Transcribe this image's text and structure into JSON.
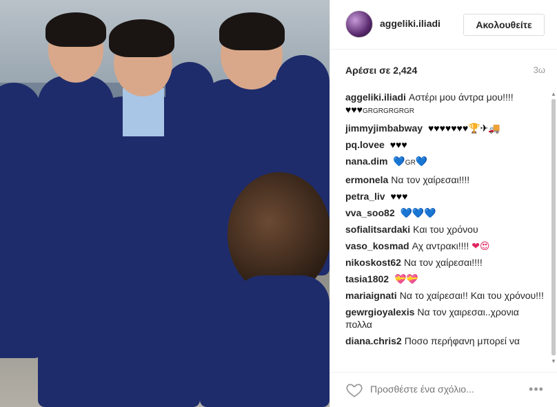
{
  "post": {
    "username": "aggeliki.iliadi",
    "follow_label": "Ακολουθείτε",
    "likes_text": "Αρέσει σε 2,424",
    "time_ago": "3ω"
  },
  "comments": [
    {
      "user": "aggeliki.iliadi",
      "text": "Αστέρι μου άντρα μου!!!!",
      "extra_icons": "♥♥♥",
      "extra_small": "GRGRGRGRGR",
      "heart_color": "black"
    },
    {
      "user": "jimmyjimbabway",
      "text": "",
      "extra_icons": "♥♥♥♥♥♥♥🏆✈🚚",
      "heart_color": "black"
    },
    {
      "user": "pq.lovee",
      "text": "",
      "extra_icons": "♥♥♥",
      "heart_color": "black"
    },
    {
      "user": "nana.dim",
      "text": "",
      "extra_icons": "💙",
      "extra_small": "GR",
      "extra_icons_after": "💙",
      "heart_color": "blue"
    },
    {
      "user": "ermonela",
      "text": "Να τον χαίρεσαι!!!!",
      "heart_color": ""
    },
    {
      "user": "petra_liv",
      "text": "",
      "extra_icons": "♥♥♥",
      "heart_color": "black"
    },
    {
      "user": "vva_soo82",
      "text": "",
      "extra_icons": "💙💙💙",
      "heart_color": "blue"
    },
    {
      "user": "sofialitsardaki",
      "text": "Και του χρόνου",
      "heart_color": ""
    },
    {
      "user": "vaso_kosmad",
      "text": "Αχ αντρακι!!!!",
      "extra_icons": "❤😍",
      "heart_color": "red"
    },
    {
      "user": "nikoskost62",
      "text": "Να τον χαίρεσαι!!!!",
      "heart_color": ""
    },
    {
      "user": "tasia1802",
      "text": "",
      "extra_icons": "💝💝",
      "heart_color": "red"
    },
    {
      "user": "mariaignati",
      "text": "Να το χαίρεσαι!! Και του χρόνου!!!",
      "heart_color": ""
    },
    {
      "user": "gewrgioyalexis",
      "text": "Να τον χαιρεσαι..χρονια πολλα",
      "heart_color": ""
    },
    {
      "user": "diana.chris2",
      "text": "Ποσο περήφανη μπορεί να",
      "heart_color": ""
    }
  ],
  "footer": {
    "comment_placeholder": "Προσθέστε ένα σχόλιο...",
    "more_label": "•••"
  },
  "icons": {
    "like": "heart-outline-icon",
    "more": "more-options-icon",
    "scroll_up": "scroll-up-arrow",
    "scroll_down": "scroll-down-arrow"
  },
  "colors": {
    "username": "#262626",
    "muted": "#999999",
    "border": "#dbdbdb",
    "uniform": "#1f2c6b"
  }
}
